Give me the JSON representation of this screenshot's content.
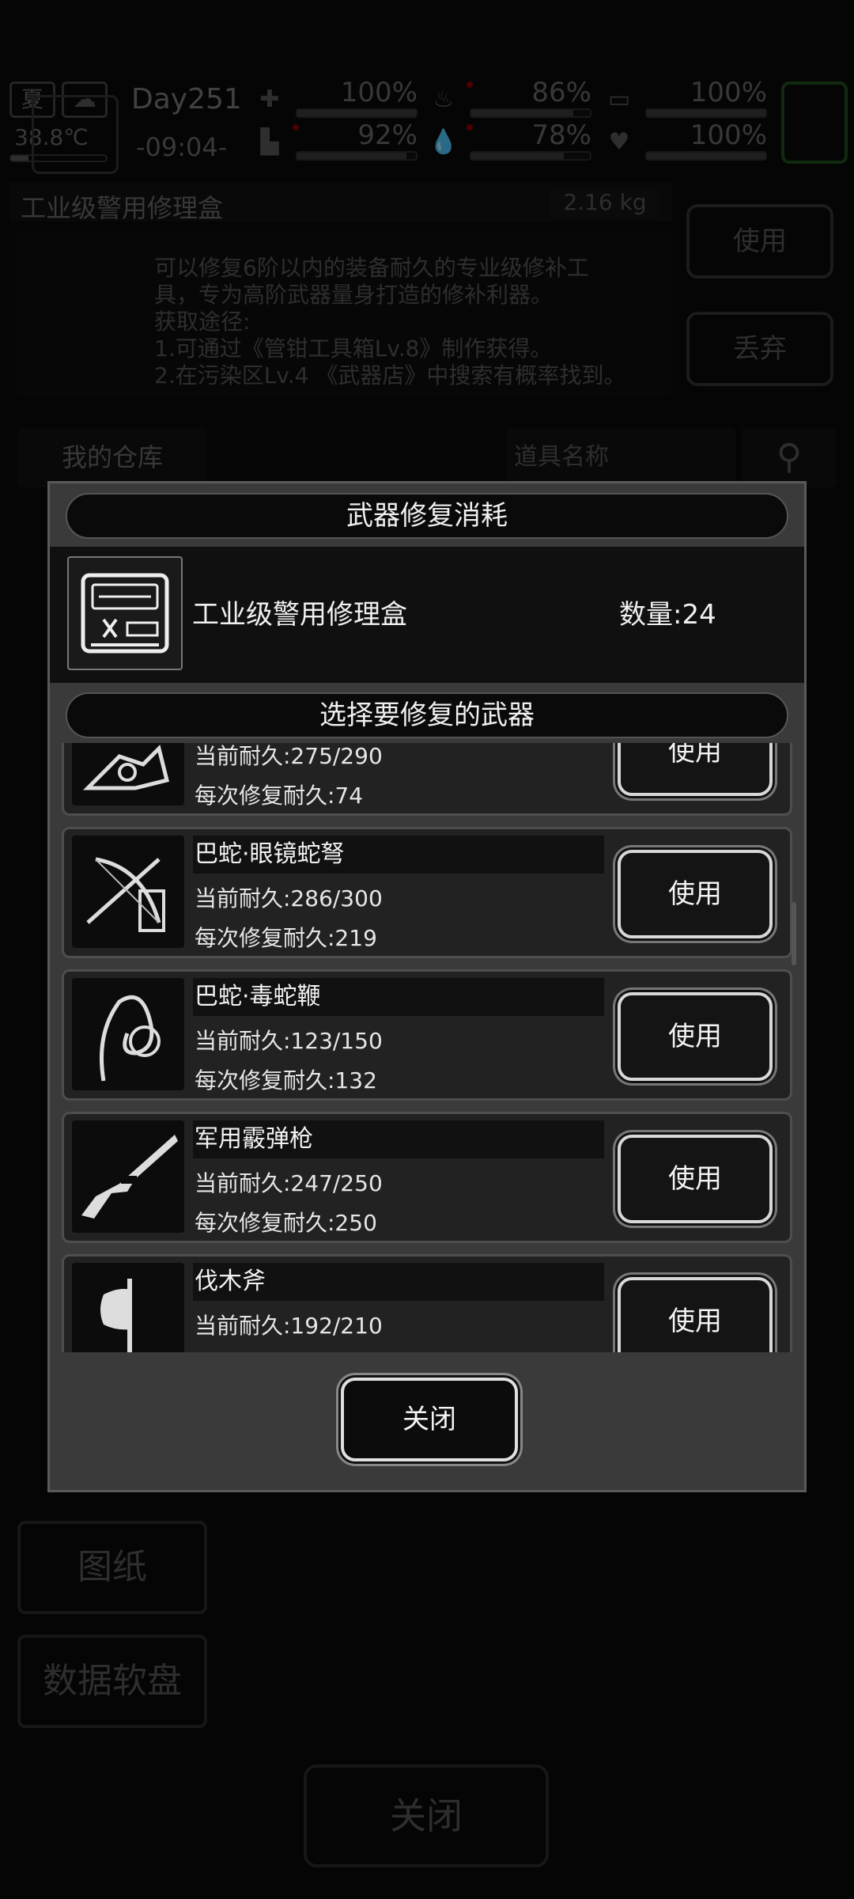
{
  "status": {
    "season": "夏",
    "temperature": "38.8℃",
    "day": "Day251",
    "time": "-09:04-",
    "stats": [
      {
        "icon": "medical-icon",
        "value": "100%",
        "level": 1.0
      },
      {
        "icon": "stomach-icon",
        "value": "86%",
        "level": 0.86
      },
      {
        "icon": "battery-icon",
        "value": "100%",
        "level": 1.0
      },
      {
        "icon": "boot-icon",
        "value": "92%",
        "level": 0.92
      },
      {
        "icon": "water-drop-icon",
        "value": "78%",
        "level": 0.78
      },
      {
        "icon": "heart-icon",
        "value": "100%",
        "level": 1.0
      }
    ]
  },
  "item": {
    "name": "工业级警用修理盒",
    "weight": "2.16 kg",
    "description": "可以修复6阶以内的装备耐久的专业级修补工\n具，专为高阶武器量身打造的修补利器。\n获取途径:\n1.可通过《管钳工具箱Lv.8》制作获得。\n2.在污染区Lv.4 《武器店》中搜索有概率找到。",
    "use_label": "使用",
    "discard_label": "丢弃"
  },
  "storage": {
    "tab_label": "我的仓库",
    "search_placeholder": "道具名称"
  },
  "side_buttons": [
    "图纸",
    "数据软盘"
  ],
  "bg_close_label": "关闭",
  "modal": {
    "title": "武器修复消耗",
    "consumable_name": "工业级警用修理盒",
    "consumable_qty": "数量:24",
    "select_title": "选择要修复的武器",
    "use_label": "使用",
    "close_label": "关闭",
    "weapons": [
      {
        "name": "",
        "durability": "当前耐久:275/290",
        "repair": "每次修复耐久:74",
        "icon": "weapon-icon"
      },
      {
        "name": "巴蛇·眼镜蛇弩",
        "durability": "当前耐久:286/300",
        "repair": "每次修复耐久:219",
        "icon": "crossbow-icon"
      },
      {
        "name": "巴蛇·毒蛇鞭",
        "durability": "当前耐久:123/150",
        "repair": "每次修复耐久:132",
        "icon": "whip-icon"
      },
      {
        "name": "军用霰弹枪",
        "durability": "当前耐久:247/250",
        "repair": "每次修复耐久:250",
        "icon": "shotgun-icon"
      },
      {
        "name": "伐木斧",
        "durability": "当前耐久:192/210",
        "repair": "",
        "icon": "axe-icon"
      }
    ]
  }
}
